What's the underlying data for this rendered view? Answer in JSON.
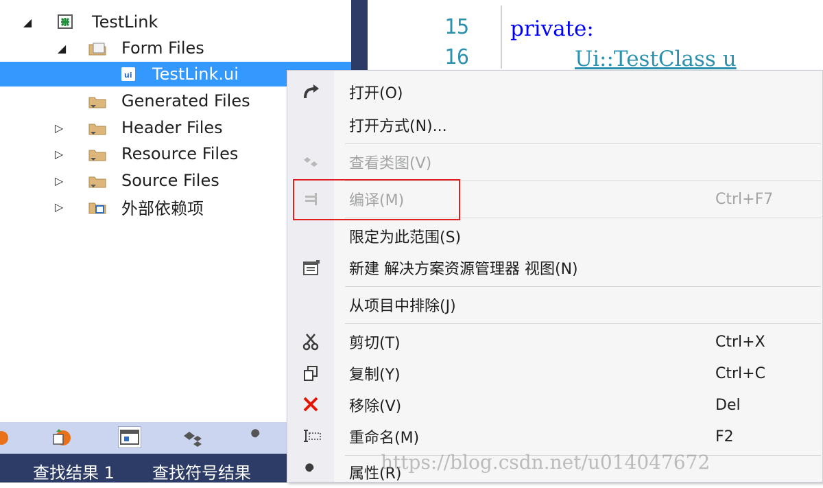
{
  "tree": {
    "project": "TestLink",
    "form_files": "Form Files",
    "selected_file": "TestLink.ui",
    "generated_files": "Generated Files",
    "header_files": "Header Files",
    "resource_files": "Resource Files",
    "source_files": "Source Files",
    "external_deps": "外部依赖项"
  },
  "tabs": {
    "find_results": "查找结果 1",
    "find_symbol_results": "查找符号结果"
  },
  "editor": {
    "lines": [
      {
        "number": "15",
        "text": "private:"
      },
      {
        "number": "16",
        "text": "Ui::TestClass u"
      }
    ]
  },
  "menu": {
    "open": "打开(O)",
    "open_with": "打开方式(N)...",
    "view_class_diagram": "查看类图(V)",
    "compile": "编译(M)",
    "compile_shortcut": "Ctrl+F7",
    "scope_to_this": "限定为此范围(S)",
    "new_view": "新建 解决方案资源管理器 视图(N)",
    "exclude": "从项目中排除(J)",
    "cut": "剪切(T)",
    "cut_shortcut": "Ctrl+X",
    "copy": "复制(Y)",
    "copy_shortcut": "Ctrl+C",
    "remove": "移除(V)",
    "remove_shortcut": "Del",
    "rename": "重命名(M)",
    "rename_shortcut": "F2",
    "properties": "属性(R)"
  },
  "watermark": "https://blog.csdn.net/u014047672",
  "colors": {
    "selection": "#3399ff",
    "highlight_box": "#e02020",
    "panel_dark": "#2d3c66",
    "remove_icon": "#e51400"
  }
}
